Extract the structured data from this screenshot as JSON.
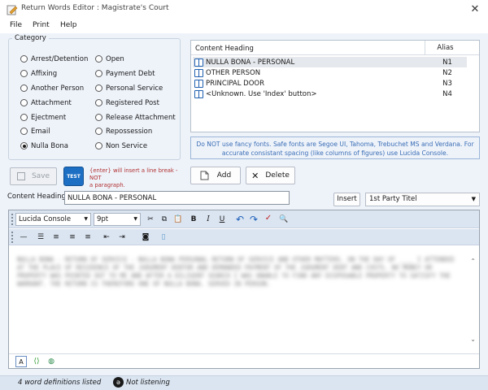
{
  "window": {
    "title": "Return Words Editor : Magistrate's Court"
  },
  "menu": [
    "File",
    "Print",
    "Help"
  ],
  "category": {
    "legend": "Category",
    "options_left": [
      "Arrest/Detention",
      "Affixing",
      "Another Person",
      "Attachment",
      "Ejectment",
      "Email",
      "Nulla Bona"
    ],
    "options_right": [
      "Open",
      "Payment Debt",
      "Personal Service",
      "Registered Post",
      "Release Attachment",
      "Repossession",
      "Non Service"
    ],
    "selected": "Nulla Bona"
  },
  "list": {
    "col_heading": "Content Heading",
    "col_alias": "Alias",
    "rows": [
      {
        "heading": "NULLA BONA - PERSONAL",
        "alias": "N1"
      },
      {
        "heading": "OTHER PERSON",
        "alias": "N2"
      },
      {
        "heading": "PRINCIPAL DOOR",
        "alias": "N3"
      },
      {
        "heading": "<Unknown. Use 'Index' button>",
        "alias": "N4"
      }
    ]
  },
  "note": {
    "line1": "Do NOT use fancy fonts. Safe fonts are Segoe UI, Tahoma, Trebuchet MS and Verdana. For",
    "line2": "accurate consistant spacing (like columns of figures) use Lucida Console."
  },
  "buttons": {
    "save": "Save",
    "test": "TEST",
    "add": "Add",
    "delete": "Delete",
    "insert": "Insert"
  },
  "hint": {
    "line1": "{enter} will insert a line break - NOT",
    "line2": "a paragraph."
  },
  "content_heading": {
    "label": "Content Heading",
    "value": "NULLA BONA - PERSONAL"
  },
  "insert_combo": {
    "value": "1st Party Titel"
  },
  "editor": {
    "font": "Lucida Console",
    "size": "9pt",
    "body": "NULLA BONA - RETURN OF SERVICE - NULLA BONA PERSONAL RETURN OF SERVICE AND OTHER MATTERS. ON THE DAY OF ____ I ATTENDED AT THE PLACE OF RESIDENCE OF THE JUDGMENT DEBTOR AND DEMANDED PAYMENT OF THE JUDGMENT DEBT AND COSTS. NO MONEY OR PROPERTY WAS POINTED OUT TO ME AND AFTER A DILIGENT SEARCH I WAS UNABLE TO FIND ANY DISPOSABLE PROPERTY TO SATISFY THE WARRANT. THE RETURN IS THEREFORE ONE OF NULLA BONA. SERVED IN PERSON."
  },
  "status": {
    "definitions": "4 word definitions listed",
    "listening": "Not listening"
  },
  "colors": {
    "accent": "#1d6fc4",
    "note_text": "#3a6db5",
    "hint_text": "#b03030"
  }
}
